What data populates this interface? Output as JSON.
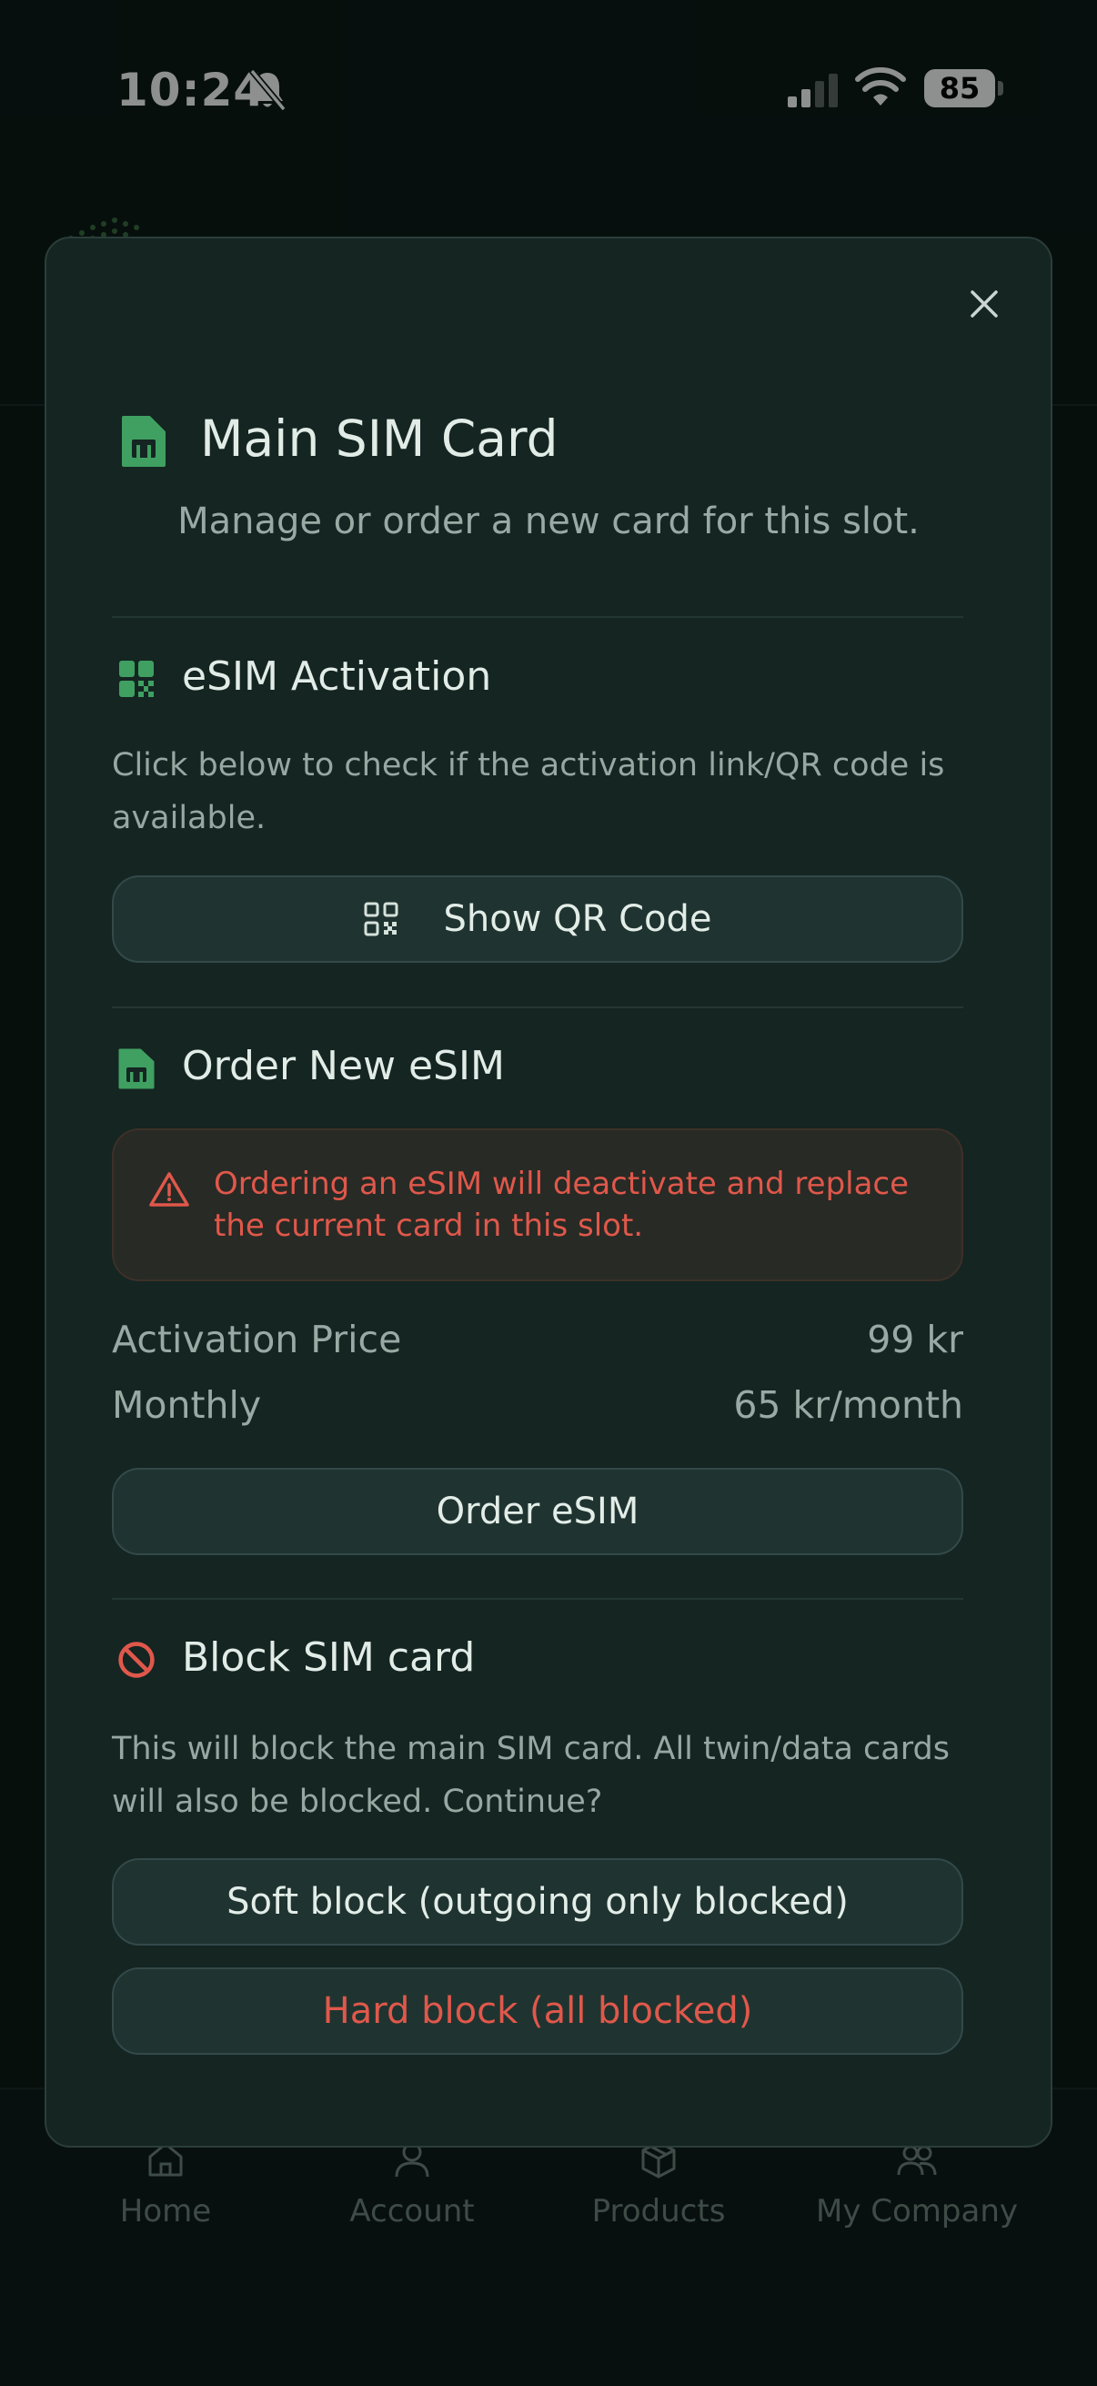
{
  "status_bar": {
    "time": "10:24",
    "battery": "85",
    "icons": [
      "bell-slash-icon",
      "signal-icon",
      "wifi-icon",
      "battery-icon"
    ]
  },
  "bottom_nav": {
    "items": [
      {
        "label": "Home",
        "icon": "home-icon"
      },
      {
        "label": "Account",
        "icon": "person-icon"
      },
      {
        "label": "Products",
        "icon": "box-icon"
      },
      {
        "label": "My Company",
        "icon": "people-icon"
      }
    ]
  },
  "modal": {
    "title": "Main SIM Card",
    "subtitle": "Manage or order a new card for this slot.",
    "esim_activation": {
      "title": "eSIM Activation",
      "description": "Click below to check if the activation link/QR code is available.",
      "button": "Show QR Code"
    },
    "order_esim": {
      "title": "Order New eSIM",
      "warning": "Ordering an eSIM will deactivate and replace the current card in this slot.",
      "activation_price_label": "Activation Price",
      "activation_price_value": "99 kr",
      "monthly_label": "Monthly",
      "monthly_value": "65 kr/month",
      "button": "Order eSIM"
    },
    "block_sim": {
      "title": "Block SIM card",
      "description": "This will block the main SIM card. All twin/data cards will also be blocked. Continue?",
      "soft_block_button": "Soft block (outgoing only blocked)",
      "hard_block_button": "Hard block (all blocked)"
    }
  },
  "colors": {
    "accent_green": "#3fa061",
    "danger_red": "#e0584b",
    "modal_bg": "#142522",
    "page_bg": "#0b1413"
  }
}
